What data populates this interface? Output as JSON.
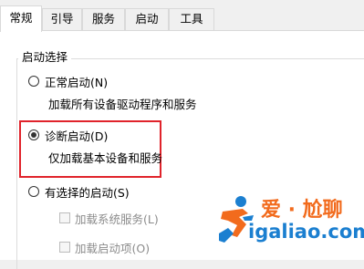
{
  "tabs": [
    {
      "label": "常规",
      "active": true
    },
    {
      "label": "引导",
      "active": false
    },
    {
      "label": "服务",
      "active": false
    },
    {
      "label": "启动",
      "active": false
    },
    {
      "label": "工具",
      "active": false
    }
  ],
  "startup_selection": {
    "title": "启动选择",
    "options": [
      {
        "label": "正常启动(N)",
        "description": "加载所有设备驱动程序和服务",
        "selected": false
      },
      {
        "label": "诊断启动(D)",
        "description": "仅加载基本设备和服务",
        "selected": true
      },
      {
        "label": "有选择的启动(S)",
        "selected": false
      }
    ],
    "selective_items": [
      {
        "label": "加载系统服务(L)",
        "checked": false,
        "enabled": false
      },
      {
        "label": "加载启动项(O)",
        "checked": false,
        "enabled": false
      }
    ]
  },
  "watermark": {
    "text_cn": "爱 · 尬聊",
    "text_en": "igaliao.com",
    "colors": {
      "orange": "#f26b1d",
      "blue": "#1b7fd0"
    }
  },
  "colors": {
    "highlight": "#e0232b"
  }
}
